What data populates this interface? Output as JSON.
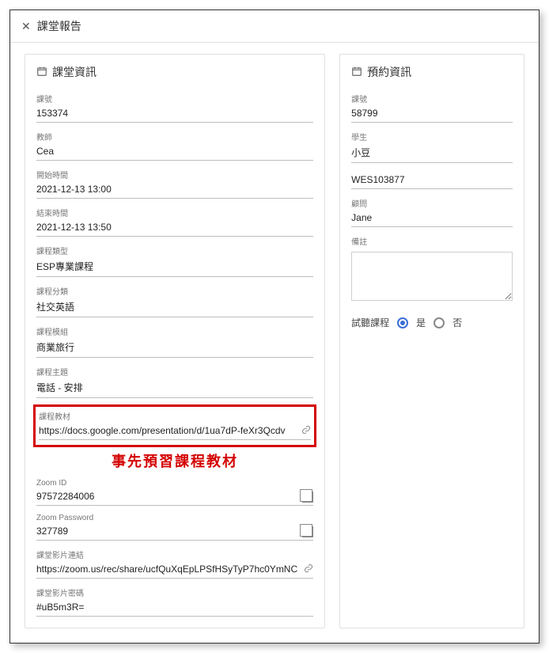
{
  "header": {
    "title": "課堂報告"
  },
  "left": {
    "panel_title": "課堂資訊",
    "fields": {
      "class_no_label": "課號",
      "class_no": "153374",
      "teacher_label": "教師",
      "teacher": "Cea",
      "start_label": "開始時間",
      "start": "2021-12-13 13:00",
      "end_label": "結束時間",
      "end": "2021-12-13 13:50",
      "type_label": "課程類型",
      "type": "ESP專業課程",
      "category_label": "課程分類",
      "category": "社交英語",
      "module_label": "課程模組",
      "module": "商業旅行",
      "topic_label": "課程主題",
      "topic": "電話 - 安排",
      "material_label": "課程教材",
      "material": "https://docs.google.com/presentation/d/1ua7dP-feXr3Qcdv",
      "zoom_id_label": "Zoom ID",
      "zoom_id": "97572284006",
      "zoom_pw_label": "Zoom Password",
      "zoom_pw": "327789",
      "rec_label": "課堂影片連結",
      "rec": "https://zoom.us/rec/share/ucfQuXqEpLPSfHSyTyP7hc0YmNC",
      "rec_pw_label": "課堂影片密碼",
      "rec_pw": "#uB5m3R="
    }
  },
  "right": {
    "panel_title": "預約資訊",
    "fields": {
      "book_no_label": "課號",
      "book_no": "58799",
      "student_label": "學生",
      "student": "小豆",
      "code_label": "",
      "code": "WES103877",
      "advisor_label": "顧問",
      "advisor": "Jane",
      "notes_label": "備註",
      "trial_label": "試聽課程",
      "opt_yes": "是",
      "opt_no": "否"
    }
  },
  "annotation": "事先預習課程教材"
}
